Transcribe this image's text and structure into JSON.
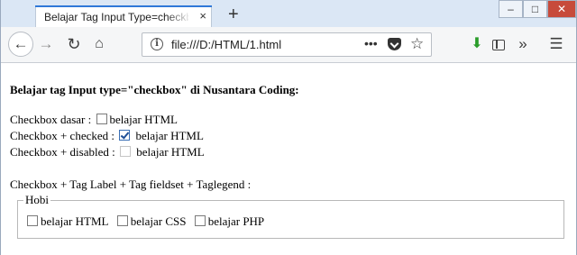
{
  "tab": {
    "title": "Belajar Tag Input Type=checkbox H",
    "close": "×",
    "new_tab": "+"
  },
  "window_controls": {
    "minimize": "–",
    "maximize": "□",
    "close": "✕"
  },
  "toolbar": {
    "back": "←",
    "forward": "→",
    "reload": "↻",
    "home": "⌂",
    "url": "file:///D:/HTML/1.html",
    "page_actions": "•••",
    "bookmark": "☆",
    "download": "⬇",
    "overflow": "»",
    "menu": "☰"
  },
  "page": {
    "heading": "Belajar tag Input type=\"checkbox\" di Nusantara Coding:",
    "rows": [
      {
        "prefix": "Checkbox dasar :",
        "label": "belajar HTML",
        "checked": false,
        "disabled": false
      },
      {
        "prefix": "Checkbox + checked :",
        "label": "belajar HTML",
        "checked": true,
        "disabled": false
      },
      {
        "prefix": "Checkbox + disabled :",
        "label": "belajar HTML",
        "checked": false,
        "disabled": true
      }
    ],
    "fieldset_title": "Checkbox + Tag Label + Tag fieldset + Taglegend :",
    "legend": "Hobi",
    "hobbies": [
      "belajar HTML",
      "belajar CSS",
      "belajar PHP"
    ]
  }
}
